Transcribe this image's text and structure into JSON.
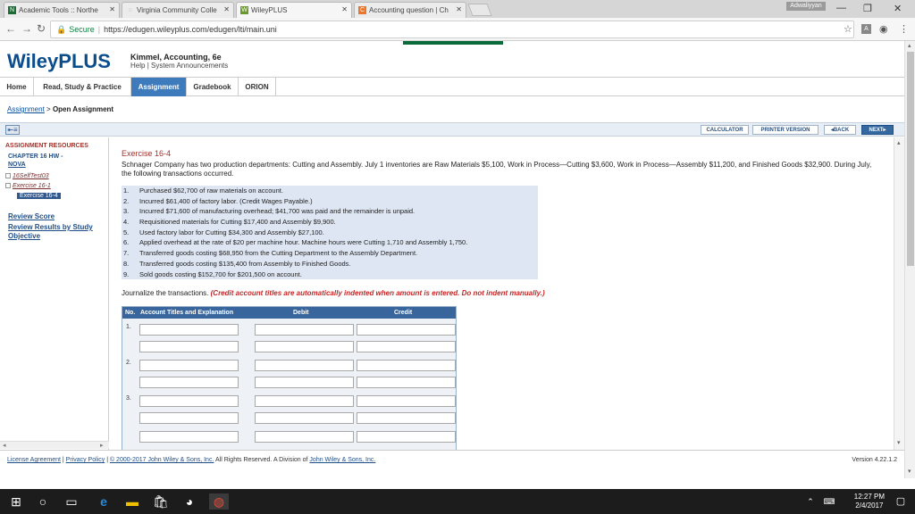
{
  "browser": {
    "tabs": [
      {
        "label": "Academic Tools :: Northe",
        "icon": "N",
        "color": "#1d6b34"
      },
      {
        "label": "Virginia Community Colle",
        "icon": "",
        "color": "#888888"
      },
      {
        "label": "WileyPLUS",
        "icon": "W",
        "color": "#6a9a2d"
      },
      {
        "label": "Accounting question | Ch",
        "icon": "C",
        "color": "#e8762c"
      }
    ],
    "user_badge": "Adwaliyyan",
    "secure_label": "Secure",
    "url": "https://edugen.wileyplus.com/edugen/lti/main.uni"
  },
  "header": {
    "logo": "WileyPLUS",
    "book_title": "Kimmel, Accounting, 6e",
    "help": "Help",
    "system_announcements": "System Announcements",
    "help_separator": "|"
  },
  "nav": {
    "tabs": [
      "Home",
      "Read, Study & Practice",
      "Assignment",
      "Gradebook",
      "ORION"
    ],
    "active": "Assignment"
  },
  "breadcrumb": {
    "link": "Assignment",
    "separator": ">",
    "current": "Open Assignment"
  },
  "toolbar": {
    "calculator": "CALCULATOR",
    "printer": "PRINTER VERSION",
    "back": "◂BACK",
    "next": "NEXT▸"
  },
  "sidebar": {
    "title": "ASSIGNMENT RESOURCES",
    "chapter": "CHAPTER 16 HW -",
    "chapter_link": "NOVA",
    "tree": [
      "16SelfTest03",
      "Exercise 16-1"
    ],
    "selected": "Exercise 16-4",
    "review_score": "Review Score",
    "review_results": "Review Results by Study Objective"
  },
  "exercise": {
    "title": "Exercise 16-4",
    "problem": "Schnager Company has two production departments: Cutting and Assembly. July 1 inventories are Raw Materials $5,100, Work in Process—Cutting $3,600, Work in Process—Assembly $11,200, and Finished Goods $32,900. During July, the following transactions occurred.",
    "transactions": [
      {
        "num": "1.",
        "text": "Purchased $62,700 of raw materials on account."
      },
      {
        "num": "2.",
        "text": "Incurred $61,400 of factory labor. (Credit Wages Payable.)"
      },
      {
        "num": "3.",
        "text": "Incurred $71,600 of manufacturing overhead; $41,700 was paid and the remainder is unpaid."
      },
      {
        "num": "4.",
        "text": "Requisitioned materials for Cutting $17,400 and Assembly $9,900."
      },
      {
        "num": "5.",
        "text": "Used factory labor for Cutting $34,300 and Assembly $27,100."
      },
      {
        "num": "6.",
        "text": "Applied overhead at the rate of $20 per machine hour. Machine hours were Cutting 1,710 and Assembly 1,750."
      },
      {
        "num": "7.",
        "text": "Transferred goods costing $68,950 from the Cutting Department to the Assembly Department."
      },
      {
        "num": "8.",
        "text": "Transferred goods costing $135,400 from Assembly to Finished Goods."
      },
      {
        "num": "9.",
        "text": "Sold goods costing $152,700 for $201,500 on account."
      }
    ],
    "instruction": "Journalize the transactions.",
    "instruction_note": "(Credit account titles are automatically indented when amount is entered. Do not indent manually.)",
    "table_headers": {
      "no": "No.",
      "account": "Account Titles and Explanation",
      "debit": "Debit",
      "credit": "Credit"
    },
    "entries": [
      "1.",
      "2.",
      "3."
    ]
  },
  "footer": {
    "license": "License Agreement",
    "privacy": "Privacy Policy",
    "copyright": "© 2000-2017 John Wiley & Sons, Inc.",
    "rights": "All Rights Reserved. A Division of",
    "company_link": "John Wiley & Sons, Inc.",
    "version": "Version 4.22.1.2"
  },
  "taskbar": {
    "time": "12:27 PM",
    "date": "2/4/2017"
  }
}
